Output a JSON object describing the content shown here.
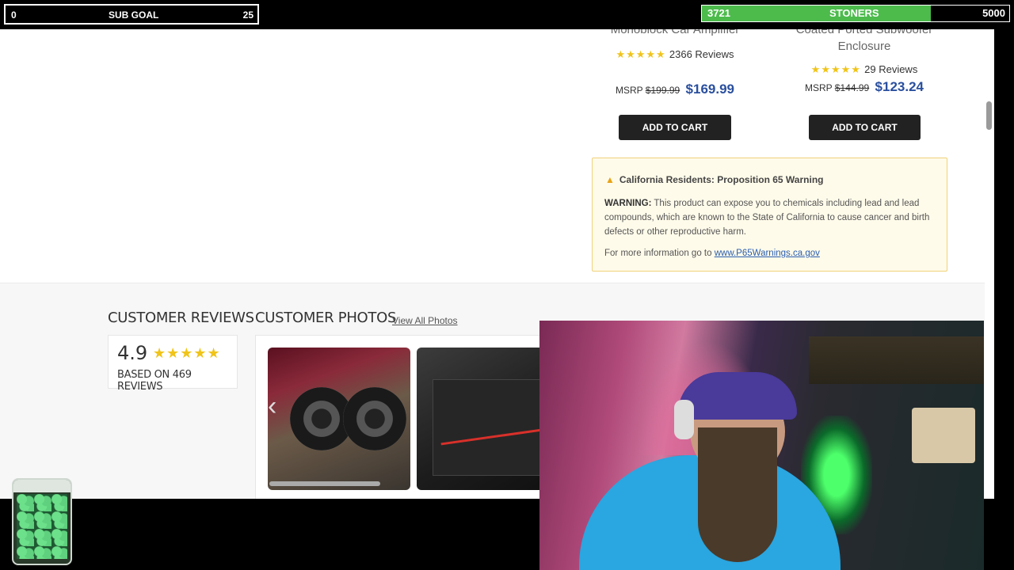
{
  "overlay": {
    "sub_goal": {
      "current": "0",
      "label": "SUB GOAL",
      "target": "25"
    },
    "stoners_goal": {
      "current": "3721",
      "label": "STONERS",
      "target": "5000",
      "progress_fraction": 0.7442
    }
  },
  "products": [
    {
      "title": "Monoblock Car Amplifier",
      "stars": "★★★★★",
      "reviews": "2366 Reviews",
      "msrp_label": "MSRP",
      "msrp": "$199.99",
      "price": "$169.99",
      "cart": "ADD TO CART"
    },
    {
      "title_line1": "Coated Ported Subwoofer",
      "title_line2": "Enclosure",
      "stars": "★★★★★",
      "reviews": "29 Reviews",
      "msrp_label": "MSRP",
      "msrp": "$144.99",
      "price": "$123.24",
      "cart": "ADD TO CART"
    }
  ],
  "warning": {
    "icon": "warning-triangle-icon",
    "heading": "California Residents: Proposition 65 Warning",
    "label": "WARNING:",
    "text": " This product can expose you to chemicals including lead and lead compounds, which are known to the State of California to cause cancer and birth defects or other reproductive harm.",
    "more_text": "For more information go to ",
    "link": "www.P65Warnings.ca.gov"
  },
  "reviews": {
    "customer_reviews_title": "CUSTOMER REVIEWS",
    "customer_photos_title": "CUSTOMER PHOTOS",
    "view_all": "View All Photos",
    "rating": "4.9",
    "stars": "★★★★★",
    "based_on": "BASED ON 469 REVIEWS"
  },
  "colors": {
    "accent_price": "#2a4f9e",
    "star": "#f0c419",
    "goal_fill": "#4cbb4c"
  }
}
